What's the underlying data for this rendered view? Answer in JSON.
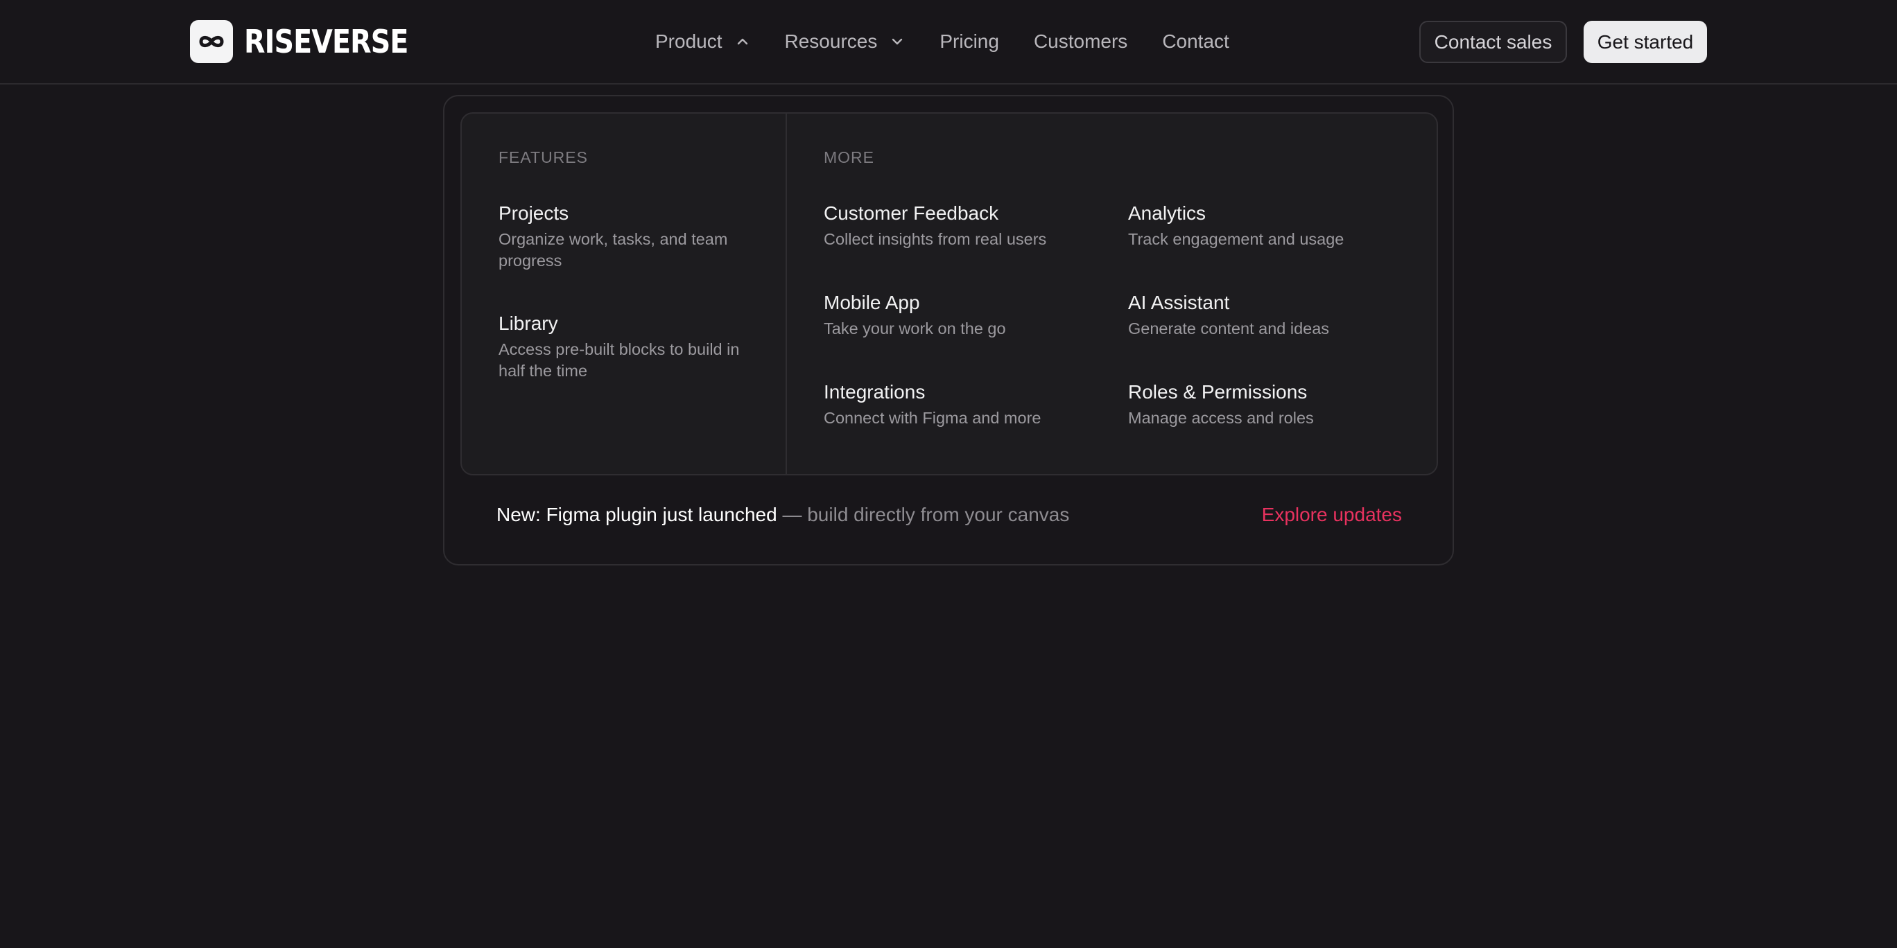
{
  "brand": {
    "name": "RISEVERSE",
    "logo_icon": "infinity-icon"
  },
  "nav": {
    "items": [
      {
        "label": "Product",
        "icon": "chevron-up-icon",
        "expanded": true
      },
      {
        "label": "Resources",
        "icon": "chevron-down-icon",
        "expanded": false
      },
      {
        "label": "Pricing"
      },
      {
        "label": "Customers"
      },
      {
        "label": "Contact"
      }
    ]
  },
  "actions": {
    "contact_sales": "Contact sales",
    "get_started": "Get started"
  },
  "menu": {
    "features": {
      "label": "FEATURES",
      "items": [
        {
          "title": "Projects",
          "desc": "Organize work, tasks, and team progress"
        },
        {
          "title": "Library",
          "desc": "Access pre-built blocks to build in half the time"
        }
      ]
    },
    "more": {
      "label": "MORE",
      "items": [
        {
          "title": "Customer Feedback",
          "desc": "Collect insights from real users"
        },
        {
          "title": "Analytics",
          "desc": "Track engagement and usage"
        },
        {
          "title": "Mobile App",
          "desc": "Take your work on the go"
        },
        {
          "title": "AI Assistant",
          "desc": "Generate content and ideas"
        },
        {
          "title": "Integrations",
          "desc": "Connect with Figma and more"
        },
        {
          "title": "Roles & Permissions",
          "desc": "Manage access and roles"
        }
      ]
    },
    "promo": {
      "highlight": "New: Figma plugin just launched",
      "text": " — build directly from your canvas",
      "link": "Explore updates"
    }
  },
  "colors": {
    "background": "#18161a",
    "panel": "#1d1c1f",
    "border": "#2f2d31",
    "accent": "#e8325f"
  }
}
